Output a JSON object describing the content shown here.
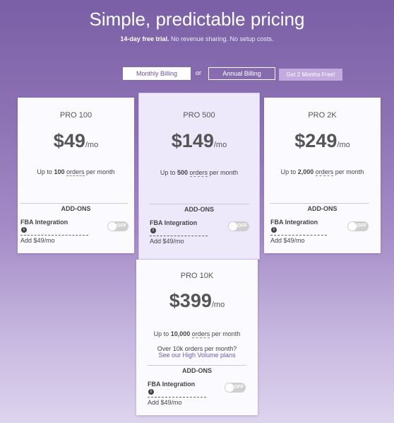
{
  "hero": {
    "title": "Simple, predictable pricing",
    "trial": "14-day free trial.",
    "sub": "No revenue sharing. No setup costs."
  },
  "billing": {
    "monthly": "Monthly Billing",
    "or": "or",
    "annual": "Annual Billing",
    "promo": "Get 2 Months Free!"
  },
  "plans": [
    {
      "name": "PRO 100",
      "price": "$49",
      "unit": "/mo",
      "desc_pre": "Up to",
      "count": "100",
      "orders": "orders",
      "desc_post": "per month"
    },
    {
      "name": "PRO 500",
      "price": "$149",
      "unit": "/mo",
      "desc_pre": "Up to",
      "count": "500",
      "orders": "orders",
      "desc_post": "per month"
    },
    {
      "name": "PRO 2K",
      "price": "$249",
      "unit": "/mo",
      "desc_pre": "Up to",
      "count": "2,000",
      "orders": "orders",
      "desc_post": "per month"
    },
    {
      "name": "PRO 10K",
      "price": "$399",
      "unit": "/mo",
      "desc_pre": "Up to",
      "count": "10,000",
      "orders": "orders",
      "desc_post": "per month"
    }
  ],
  "high_volume": {
    "line1": "Over 10k orders per month?",
    "link": "See our High Volume plans"
  },
  "addons": {
    "label": "ADD-ONS",
    "name": "FBA Integration",
    "info_glyph": "i",
    "price": "Add $49/mo",
    "toggle_state": "OFF"
  }
}
